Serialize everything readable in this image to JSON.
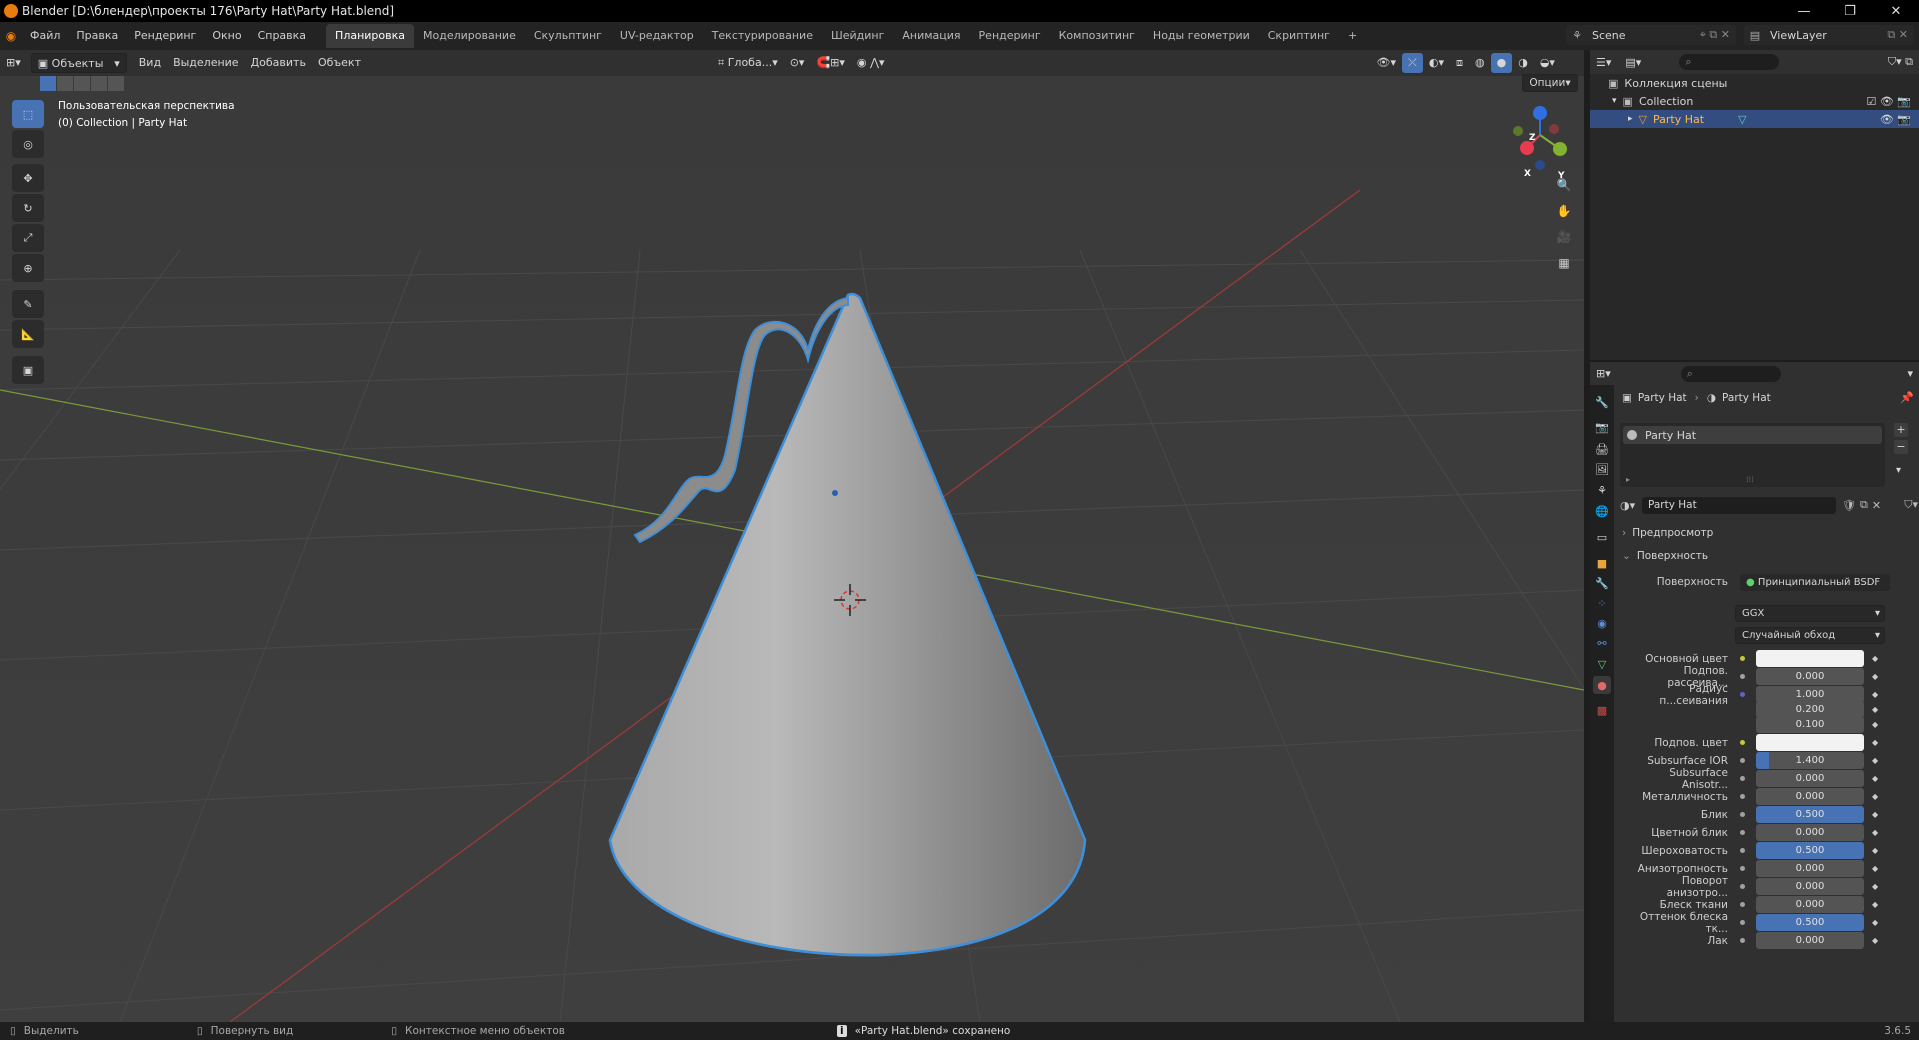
{
  "window": {
    "title": "Blender [D:\\блендер\\проекты 176\\Party Hat\\Party Hat.blend]"
  },
  "menu": [
    "Файл",
    "Правка",
    "Рендеринг",
    "Окно",
    "Справка"
  ],
  "workspaces": [
    "Планировка",
    "Моделирование",
    "Скульптинг",
    "UV-редактор",
    "Текстурирование",
    "Шейдинг",
    "Анимация",
    "Рендеринг",
    "Композитинг",
    "Ноды геометрии",
    "Скриптинг"
  ],
  "active_workspace": "Планировка",
  "scene": {
    "name": "Scene",
    "view_layer": "ViewLayer"
  },
  "viewport": {
    "mode": "Объекты",
    "menus": [
      "Вид",
      "Выделение",
      "Добавить",
      "Объект"
    ],
    "orientation": "Глоба...",
    "options_label": "Опции",
    "info_line1": "Пользовательская перспектива",
    "info_line2": "(0) Collection | Party Hat",
    "gizmo": {
      "x": "X",
      "y": "Y",
      "z": "Z"
    }
  },
  "outliner": {
    "root": "Коллекция сцены",
    "collection": "Collection",
    "object": "Party Hat"
  },
  "properties": {
    "breadcrumb_obj": "Party Hat",
    "breadcrumb_mat": "Party Hat",
    "slot": "Party Hat",
    "material_name": "Party Hat",
    "section_preview": "Предпросмотр",
    "section_surface": "Поверхность",
    "surface_label": "Поверхность",
    "surface_value": "Принципиальный BSDF",
    "distribution": "GGX",
    "subsurface_method": "Случайный обход",
    "rows": [
      {
        "label": "Основной цвет",
        "value": "",
        "kind": "color",
        "dot": "yellow",
        "fill": 0
      },
      {
        "label": "Подпов. рассеива...",
        "value": "0.000",
        "kind": "num",
        "dot": "gray",
        "fill": 0
      },
      {
        "label": "Радиус п...сеивания",
        "value": "1.000",
        "kind": "num",
        "dot": "blue",
        "fill": 0
      },
      {
        "label": "",
        "value": "0.200",
        "kind": "num",
        "dot": "none",
        "fill": 0
      },
      {
        "label": "",
        "value": "0.100",
        "kind": "num",
        "dot": "none",
        "fill": 0
      },
      {
        "label": "Подпов. цвет",
        "value": "",
        "kind": "color",
        "dot": "yellow",
        "fill": 0
      },
      {
        "label": "Subsurface IOR",
        "value": "1.400",
        "kind": "num",
        "dot": "gray",
        "fill": 0.12
      },
      {
        "label": "Subsurface Anisotr...",
        "value": "0.000",
        "kind": "num",
        "dot": "gray",
        "fill": 0
      },
      {
        "label": "Металличность",
        "value": "0.000",
        "kind": "num",
        "dot": "gray",
        "fill": 0
      },
      {
        "label": "Блик",
        "value": "0.500",
        "kind": "num",
        "dot": "gray",
        "fill": 1
      },
      {
        "label": "Цветной блик",
        "value": "0.000",
        "kind": "num",
        "dot": "gray",
        "fill": 0
      },
      {
        "label": "Шероховатость",
        "value": "0.500",
        "kind": "num",
        "dot": "gray",
        "fill": 1
      },
      {
        "label": "Анизотропность",
        "value": "0.000",
        "kind": "num",
        "dot": "gray",
        "fill": 0
      },
      {
        "label": "Поворот анизотро...",
        "value": "0.000",
        "kind": "num",
        "dot": "gray",
        "fill": 0
      },
      {
        "label": "Блеск ткани",
        "value": "0.000",
        "kind": "num",
        "dot": "gray",
        "fill": 0
      },
      {
        "label": "Оттенок блеска тк...",
        "value": "0.500",
        "kind": "num",
        "dot": "gray",
        "fill": 1
      },
      {
        "label": "Лак",
        "value": "0.000",
        "kind": "num",
        "dot": "gray",
        "fill": 0
      }
    ]
  },
  "status": {
    "select": "Выделить",
    "rotate": "Повернуть вид",
    "context": "Контекстное меню объектов",
    "message": "«Party Hat.blend» сохранено",
    "version": "3.6.5"
  },
  "colors": {
    "accent": "#4772b3",
    "selection_outline": "#3f8fd8",
    "viewport_bg": "#3d3d3d"
  }
}
